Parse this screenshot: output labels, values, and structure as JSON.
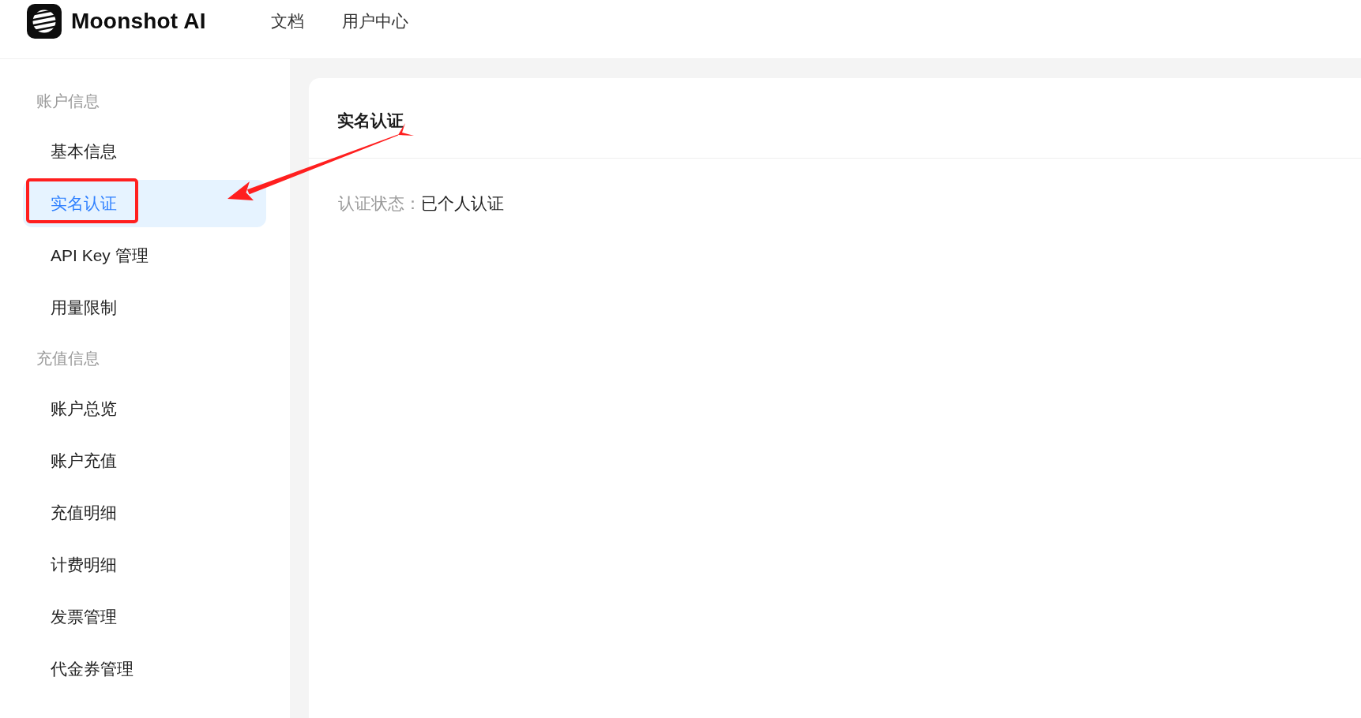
{
  "header": {
    "brand": "Moonshot AI",
    "nav": [
      {
        "label": "文档"
      },
      {
        "label": "用户中心"
      }
    ]
  },
  "sidebar": {
    "groups": [
      {
        "title": "账户信息",
        "items": [
          {
            "label": "基本信息",
            "selected": false
          },
          {
            "label": "实名认证",
            "selected": true
          },
          {
            "label": "API Key 管理",
            "selected": false
          },
          {
            "label": "用量限制",
            "selected": false
          }
        ]
      },
      {
        "title": "充值信息",
        "items": [
          {
            "label": "账户总览",
            "selected": false
          },
          {
            "label": "账户充值",
            "selected": false
          },
          {
            "label": "充值明细",
            "selected": false
          },
          {
            "label": "计费明细",
            "selected": false
          },
          {
            "label": "发票管理",
            "selected": false
          },
          {
            "label": "代金券管理",
            "selected": false
          }
        ]
      }
    ]
  },
  "content": {
    "title": "实名认证",
    "fields": [
      {
        "label": "认证状态：",
        "value": "已个人认证"
      }
    ]
  },
  "annotations": {
    "highlight_box": true,
    "arrow": true
  }
}
